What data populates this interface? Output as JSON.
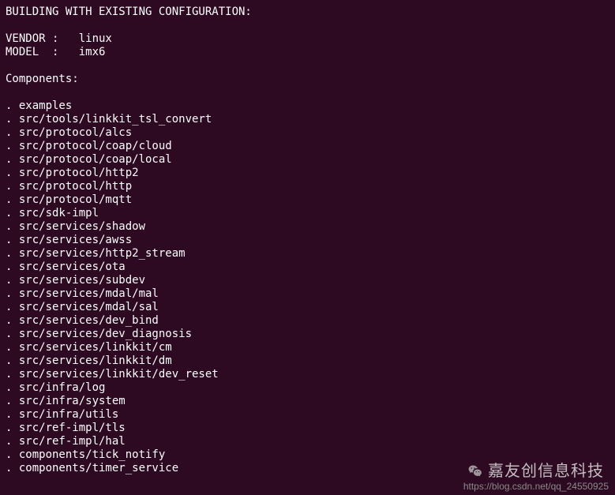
{
  "header": "BUILDING WITH EXISTING CONFIGURATION:",
  "vendor_line": "VENDOR :   linux",
  "model_line": "MODEL  :   imx6",
  "components_header": "Components:",
  "components": [
    ". examples",
    ". src/tools/linkkit_tsl_convert",
    ". src/protocol/alcs",
    ". src/protocol/coap/cloud",
    ". src/protocol/coap/local",
    ". src/protocol/http2",
    ". src/protocol/http",
    ". src/protocol/mqtt",
    ". src/sdk-impl",
    ". src/services/shadow",
    ". src/services/awss",
    ". src/services/http2_stream",
    ". src/services/ota",
    ". src/services/subdev",
    ". src/services/mdal/mal",
    ". src/services/mdal/sal",
    ". src/services/dev_bind",
    ". src/services/dev_diagnosis",
    ". src/services/linkkit/cm",
    ". src/services/linkkit/dm",
    ". src/services/linkkit/dev_reset",
    ". src/infra/log",
    ". src/infra/system",
    ". src/infra/utils",
    ". src/ref-impl/tls",
    ". src/ref-impl/hal",
    ". components/tick_notify",
    ". components/timer_service"
  ],
  "watermark": {
    "text": "嘉友创信息科技",
    "attribution": "https://blog.csdn.net/qq_24550925"
  }
}
